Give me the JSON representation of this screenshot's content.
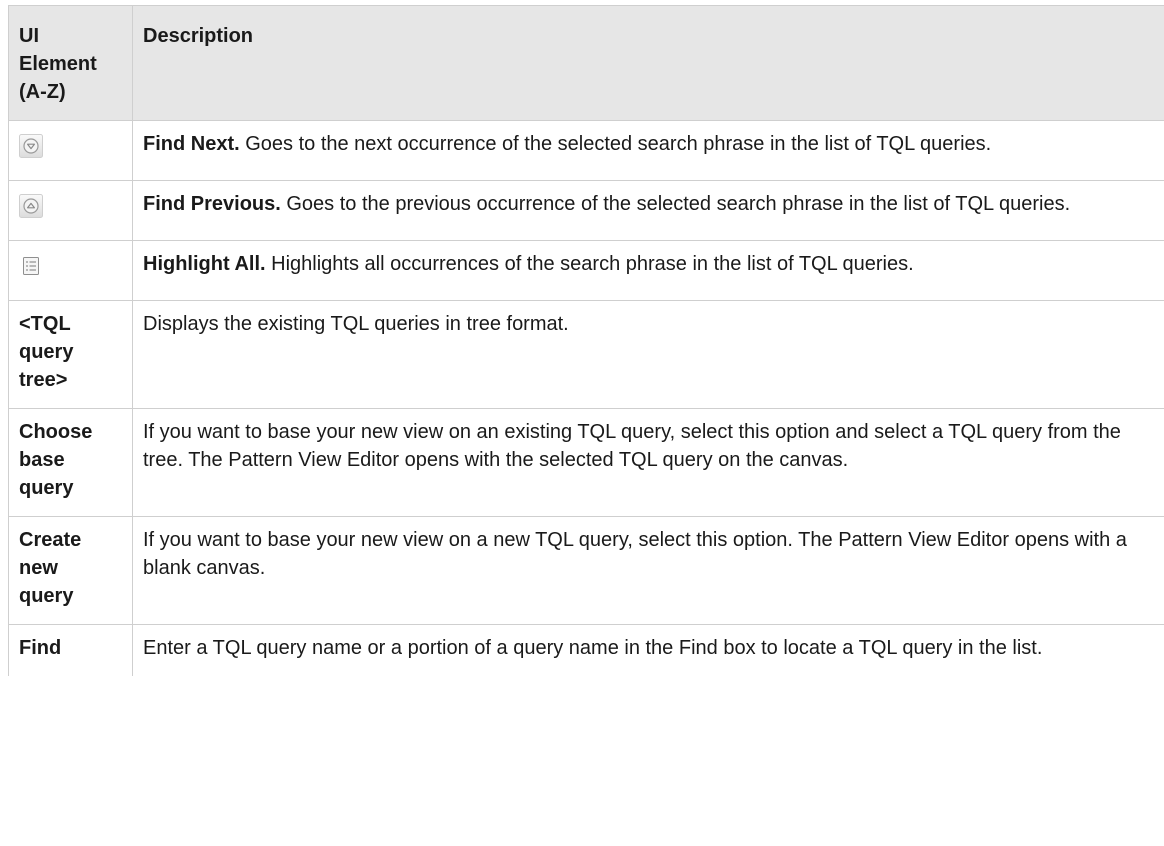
{
  "table": {
    "headers": {
      "element": [
        "UI",
        "Element",
        "(A-Z)"
      ],
      "description": "Description"
    },
    "rows": [
      {
        "icon": "find-next-icon",
        "term": "Find Next.",
        "text": " Goes to the next occurrence of the selected search phrase in the list of TQL queries."
      },
      {
        "icon": "find-previous-icon",
        "term": "Find Previous.",
        "text": " Goes to the previous occurrence of the selected search phrase in the list of TQL queries."
      },
      {
        "icon": "highlight-all-icon",
        "term": "Highlight All.",
        "text": " Highlights all occurrences of the search phrase in the list of TQL queries."
      },
      {
        "element": [
          "<TQL",
          "query",
          "tree>"
        ],
        "text": "Displays the existing TQL queries in tree format."
      },
      {
        "element": [
          "Choose",
          "base",
          "query"
        ],
        "text": "If you want to base your new view on an existing TQL query, select this option and select a TQL query from the tree. The Pattern View Editor opens with the selected TQL query on the canvas."
      },
      {
        "element": [
          "Create",
          "new",
          "query"
        ],
        "text": "If you want to base your new view on a new TQL query, select this option. The Pattern View Editor opens with a blank canvas."
      },
      {
        "element": [
          "Find"
        ],
        "text": "Enter a TQL query name or a portion of a query name in the Find box to locate a TQL query in the list."
      }
    ]
  }
}
